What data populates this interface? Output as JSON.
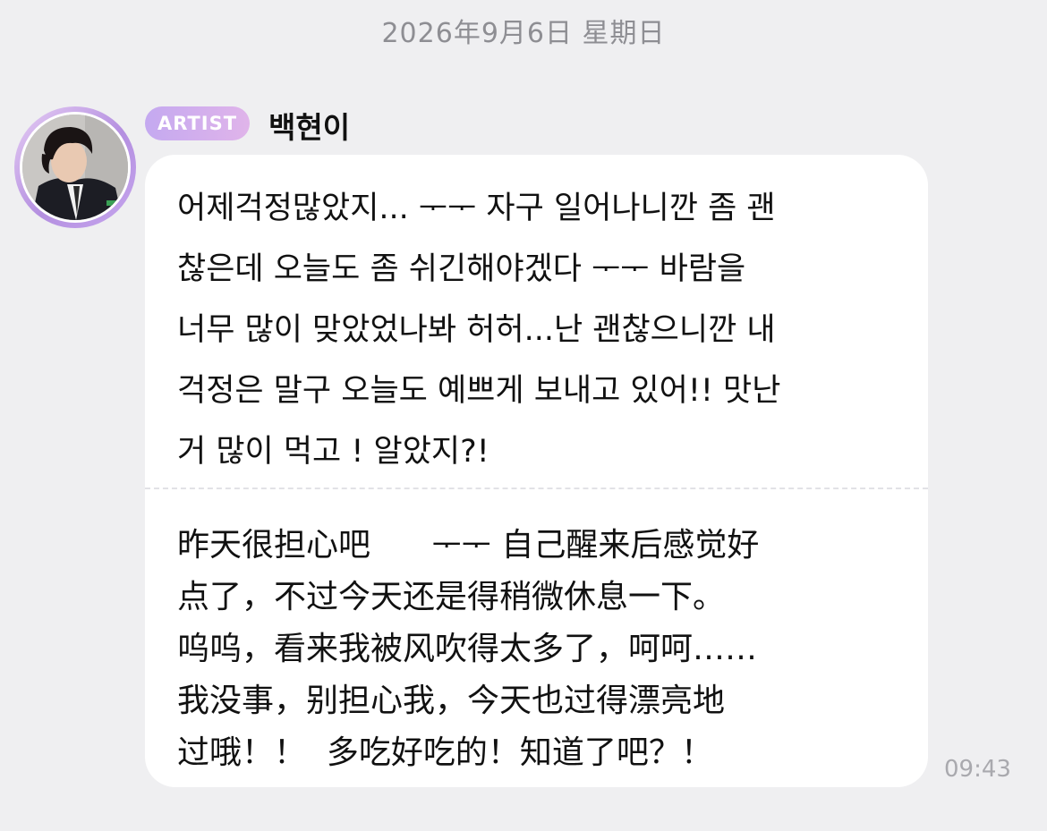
{
  "date_header": "2026年9月6日 星期日",
  "sender": {
    "badge": "ARTIST",
    "name": "백현이"
  },
  "message": {
    "korean_text": "어제걱정많았지... ᅮᅮ 자구 일어나니깐 좀 괜\n찮은데 오늘도 좀 쉬긴해야겠다 ᅮᅮ 바람을\n너무 많이 맞았었나봐 허허...난 괜찮으니깐 내\n걱정은 말구 오늘도 예쁘게 보내고 있어!! 맛난\n거 많이 먹고 ! 알았지?!",
    "chinese_text": "昨天很担心吧      ᅮᅮ 自己醒来后感觉好\n点了，不过今天还是得稍微休息一下。\n呜呜，看来我被风吹得太多了，呵呵……\n我没事，别担心我，今天也过得漂亮地\n过哦！！  多吃好吃的！知道了吧？！",
    "time": "09:43"
  },
  "colors": {
    "background": "#efeff1",
    "bubble": "#ffffff",
    "badge_start": "#c4a9f0",
    "badge_end": "#e0b4ea",
    "timestamp": "#a9a9ae"
  }
}
